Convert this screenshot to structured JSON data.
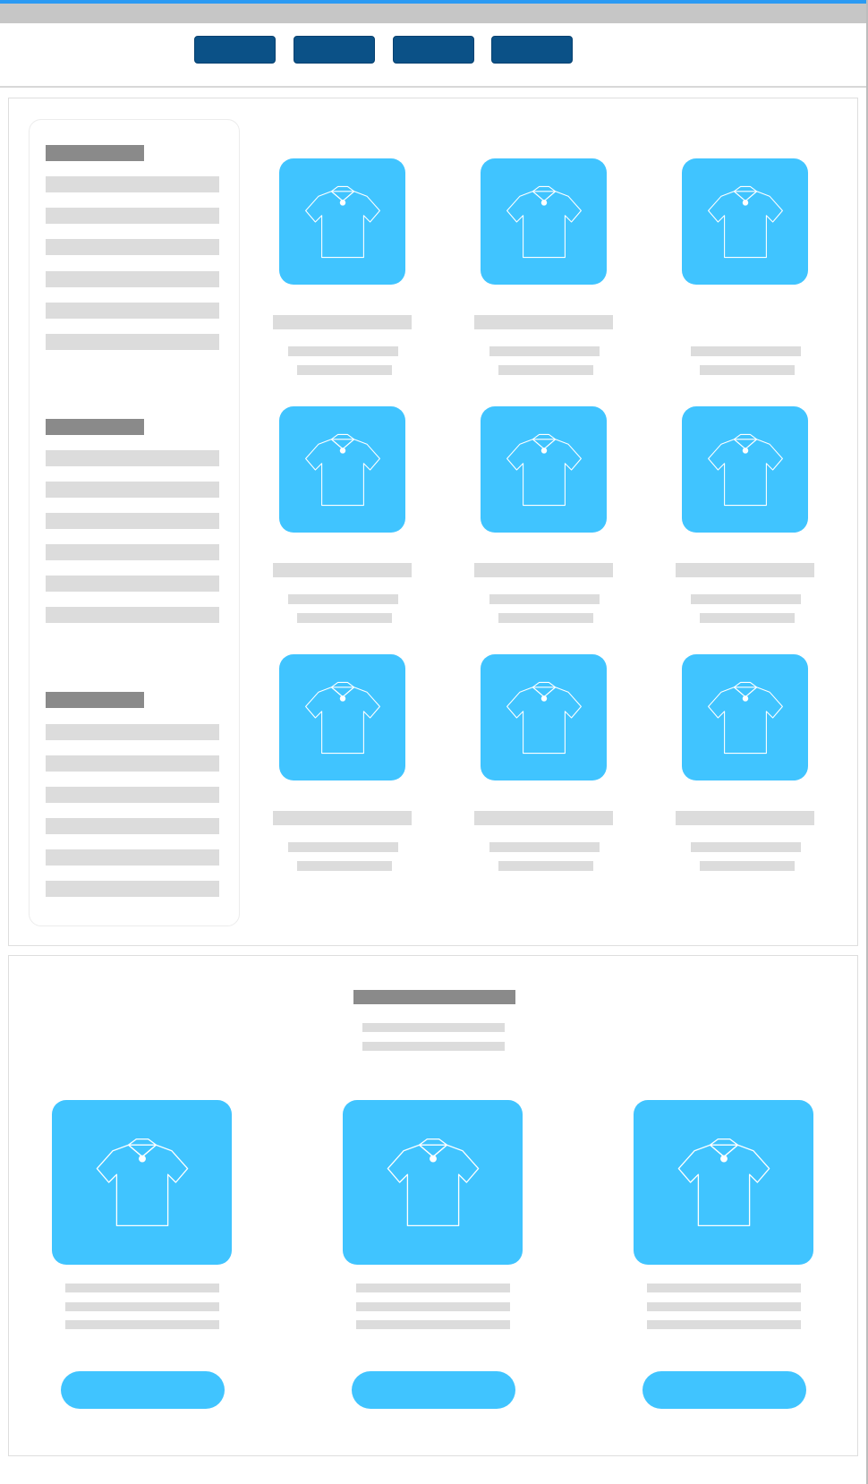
{
  "colors": {
    "accent": "#40c4ff",
    "nav_button": "#0b5187",
    "top_border": "#2b9af3",
    "placeholder_dark": "#8a8a8a",
    "placeholder_light": "#dcdcdc"
  },
  "header": {
    "nav_buttons": [
      "",
      "",
      "",
      ""
    ]
  },
  "sidebar": {
    "groups": [
      {
        "heading": "",
        "items": [
          "",
          "",
          "",
          "",
          "",
          ""
        ]
      },
      {
        "heading": "",
        "items": [
          "",
          "",
          "",
          "",
          "",
          ""
        ]
      },
      {
        "heading": "",
        "items": [
          "",
          "",
          "",
          "",
          "",
          ""
        ]
      }
    ]
  },
  "product_grid": {
    "icon": "tshirt-icon",
    "rows": 3,
    "columns": 3
  },
  "featured": {
    "icon": "tshirt-icon",
    "cards": 3
  }
}
